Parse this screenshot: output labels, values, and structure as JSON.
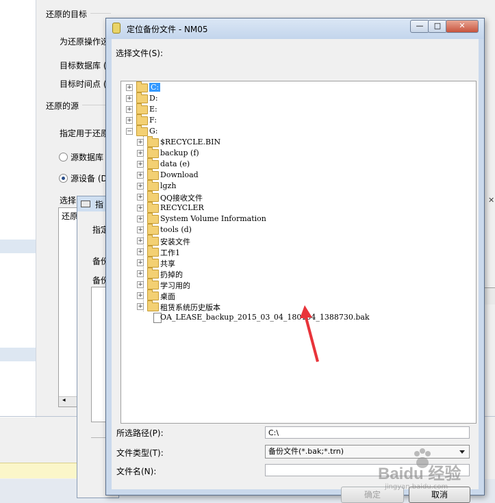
{
  "background_window": {
    "target_group": "还原的目标",
    "target_desc": "为还原操作选",
    "target_db_label": "目标数据库 (",
    "target_time_label": "目标时间点 (",
    "source_group": "还原的源",
    "source_desc": "指定用于还原",
    "radio_source_db": "源数据库",
    "radio_source_device": "源设备 (D)",
    "select_label": "选择",
    "list_first": "还原"
  },
  "middle_dialog": {
    "title": "指",
    "specify_label": "指定",
    "backup_label_1": "备份",
    "backup_label_2": "备份"
  },
  "dialog": {
    "title": "定位备份文件 - NM05",
    "select_file_label": "选择文件(S):",
    "tree": [
      {
        "label": "C:",
        "level": 0,
        "expander": "+",
        "type": "folder",
        "selected": true
      },
      {
        "label": "D:",
        "level": 0,
        "expander": "+",
        "type": "folder"
      },
      {
        "label": "E:",
        "level": 0,
        "expander": "+",
        "type": "folder"
      },
      {
        "label": "F:",
        "level": 0,
        "expander": "+",
        "type": "folder"
      },
      {
        "label": "G:",
        "level": 0,
        "expander": "-",
        "type": "folder"
      },
      {
        "label": "$RECYCLE.BIN",
        "level": 1,
        "expander": "+",
        "type": "folder"
      },
      {
        "label": "backup  (f)",
        "level": 1,
        "expander": "+",
        "type": "folder"
      },
      {
        "label": "data  (e)",
        "level": 1,
        "expander": "+",
        "type": "folder"
      },
      {
        "label": "Download",
        "level": 1,
        "expander": "+",
        "type": "folder"
      },
      {
        "label": "lgzh",
        "level": 1,
        "expander": "+",
        "type": "folder"
      },
      {
        "label": "QQ接收文件",
        "level": 1,
        "expander": "+",
        "type": "folder"
      },
      {
        "label": "RECYCLER",
        "level": 1,
        "expander": "+",
        "type": "folder"
      },
      {
        "label": "System Volume Information",
        "level": 1,
        "expander": "+",
        "type": "folder"
      },
      {
        "label": "tools  (d)",
        "level": 1,
        "expander": "+",
        "type": "folder"
      },
      {
        "label": "安装文件",
        "level": 1,
        "expander": "+",
        "type": "folder"
      },
      {
        "label": "工作1",
        "level": 1,
        "expander": "+",
        "type": "folder"
      },
      {
        "label": "共享",
        "level": 1,
        "expander": "+",
        "type": "folder"
      },
      {
        "label": "扔掉的",
        "level": 1,
        "expander": "+",
        "type": "folder"
      },
      {
        "label": "学习用的",
        "level": 1,
        "expander": "+",
        "type": "folder"
      },
      {
        "label": "桌面",
        "level": 1,
        "expander": "+",
        "type": "folder"
      },
      {
        "label": "租赁系统历史版本",
        "level": 1,
        "expander": "+",
        "type": "folder"
      },
      {
        "label": "OA_LEASE_backup_2015_03_04_180104_1388730.bak",
        "level": 1,
        "expander": "",
        "type": "file"
      }
    ],
    "selected_path_label": "所选路径(P):",
    "selected_path_value": "C:\\",
    "file_type_label": "文件类型(T):",
    "file_type_value": "备份文件(*.bak;*.trn)",
    "file_name_label": "文件名(N):",
    "file_name_value": "",
    "ok_label": "确定",
    "cancel_label": "取消",
    "minimize_glyph": "—",
    "maximize_glyph": "□",
    "close_glyph": "✕"
  },
  "overlay": {
    "arrow_color": "#e8343a",
    "watermark": "Baidu 经验",
    "watermark_sub": "jingyan.baidu.com"
  },
  "colors": {
    "selection": "#3399ff",
    "title_bar": "#c3d5ec"
  }
}
